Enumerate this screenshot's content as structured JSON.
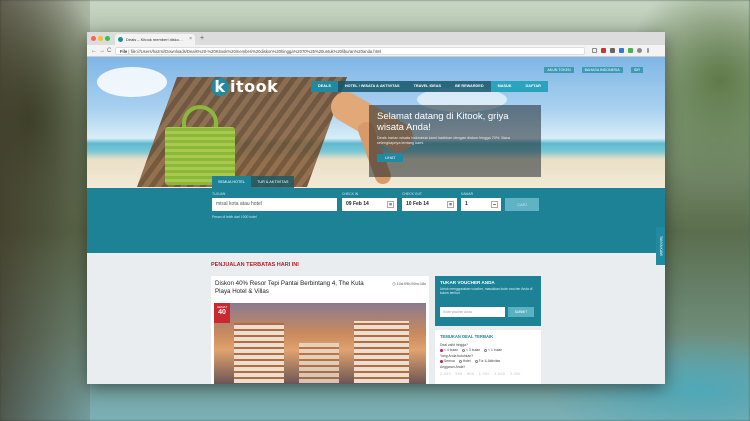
{
  "browser": {
    "tab_title": "Deals – Kitook memberi disko…",
    "new_tab": "+",
    "close": "×",
    "url": "file:///Users/hazmi/Downloads/Deals%20-%20Kitook%20memberi%20diskon%20hingga%2070%25%20untuk%20liburan%20anda.html",
    "file_label": "File",
    "nav": {
      "back": "←",
      "forward": "→",
      "reload": "C"
    }
  },
  "site": {
    "logo_letter": "k",
    "logo_text": "itook",
    "toplinks": [
      "AKUN TOKEN",
      "BAHASA INDONESIA",
      "IDR"
    ],
    "menu": [
      "DEALS",
      "HOTEL / WISATA & AKTIVITAS",
      "TRAVEL IDEAS",
      "BE REWARDED",
      "MASUK",
      "DAFTAR"
    ],
    "welcome": {
      "title": "Selamat datang di Kitook, griya wisata Anda!",
      "text": "Deals harian wisata Indonesia kami hadirkan dengan diskon hingga 70%. Baca selengkapnya tentang kami.",
      "button": "LIHAT"
    },
    "search": {
      "tabs": [
        "SEMUA HOTEL",
        "TUR & AKTIVITAS"
      ],
      "dest_label": "TUJUAN",
      "dest_placeholder": "misal kota atau hotel",
      "checkin_label": "CHECK IN",
      "checkin": "09 Feb 14",
      "checkout_label": "CHECK OUT",
      "checkout": "10 Feb 14",
      "rooms_label": "KAMAR",
      "rooms": "1",
      "hint": "Pesan di lebih dari 1000 hotel",
      "button": "CARI"
    },
    "side_tab": "TANYA KAMI",
    "section_title": "PENJUALAN TERBATAS HARI INI",
    "deal": {
      "title": "Diskon 40% Resor Tepi Pantai Berbintang 4, The Kuta Playa Hotel & Villas",
      "timer": "10d:09h:59m:18s",
      "badge_top": "HEMAT",
      "badge_value": "40"
    },
    "voucher": {
      "title": "TUKAR VOUCHER ANDA",
      "text": "Untuk menggunakan voucher, masukkan kode voucher Anda di kolom berikut",
      "placeholder": "Kode voucher Anda",
      "button": "SUBMIT"
    },
    "best": {
      "title": "TEMUKAN DEAL TERBAIK",
      "q1": "Deal valid hingga?",
      "q1_opts": [
        "< 4 bulan",
        "< 3 bulan",
        "< 1 bulan"
      ],
      "q2": "Yang Anda butuhkan?",
      "q2_opts": [
        "Semua",
        "Hotel",
        "Tur & Aktivitas"
      ],
      "q3": "Anggaran Anda?",
      "scale": "1.000 · 500 · 800 · 1.000 · 2.000 · 3.000"
    }
  },
  "colors": {
    "accent": "#1d8296",
    "sale_red": "#b0232a"
  }
}
